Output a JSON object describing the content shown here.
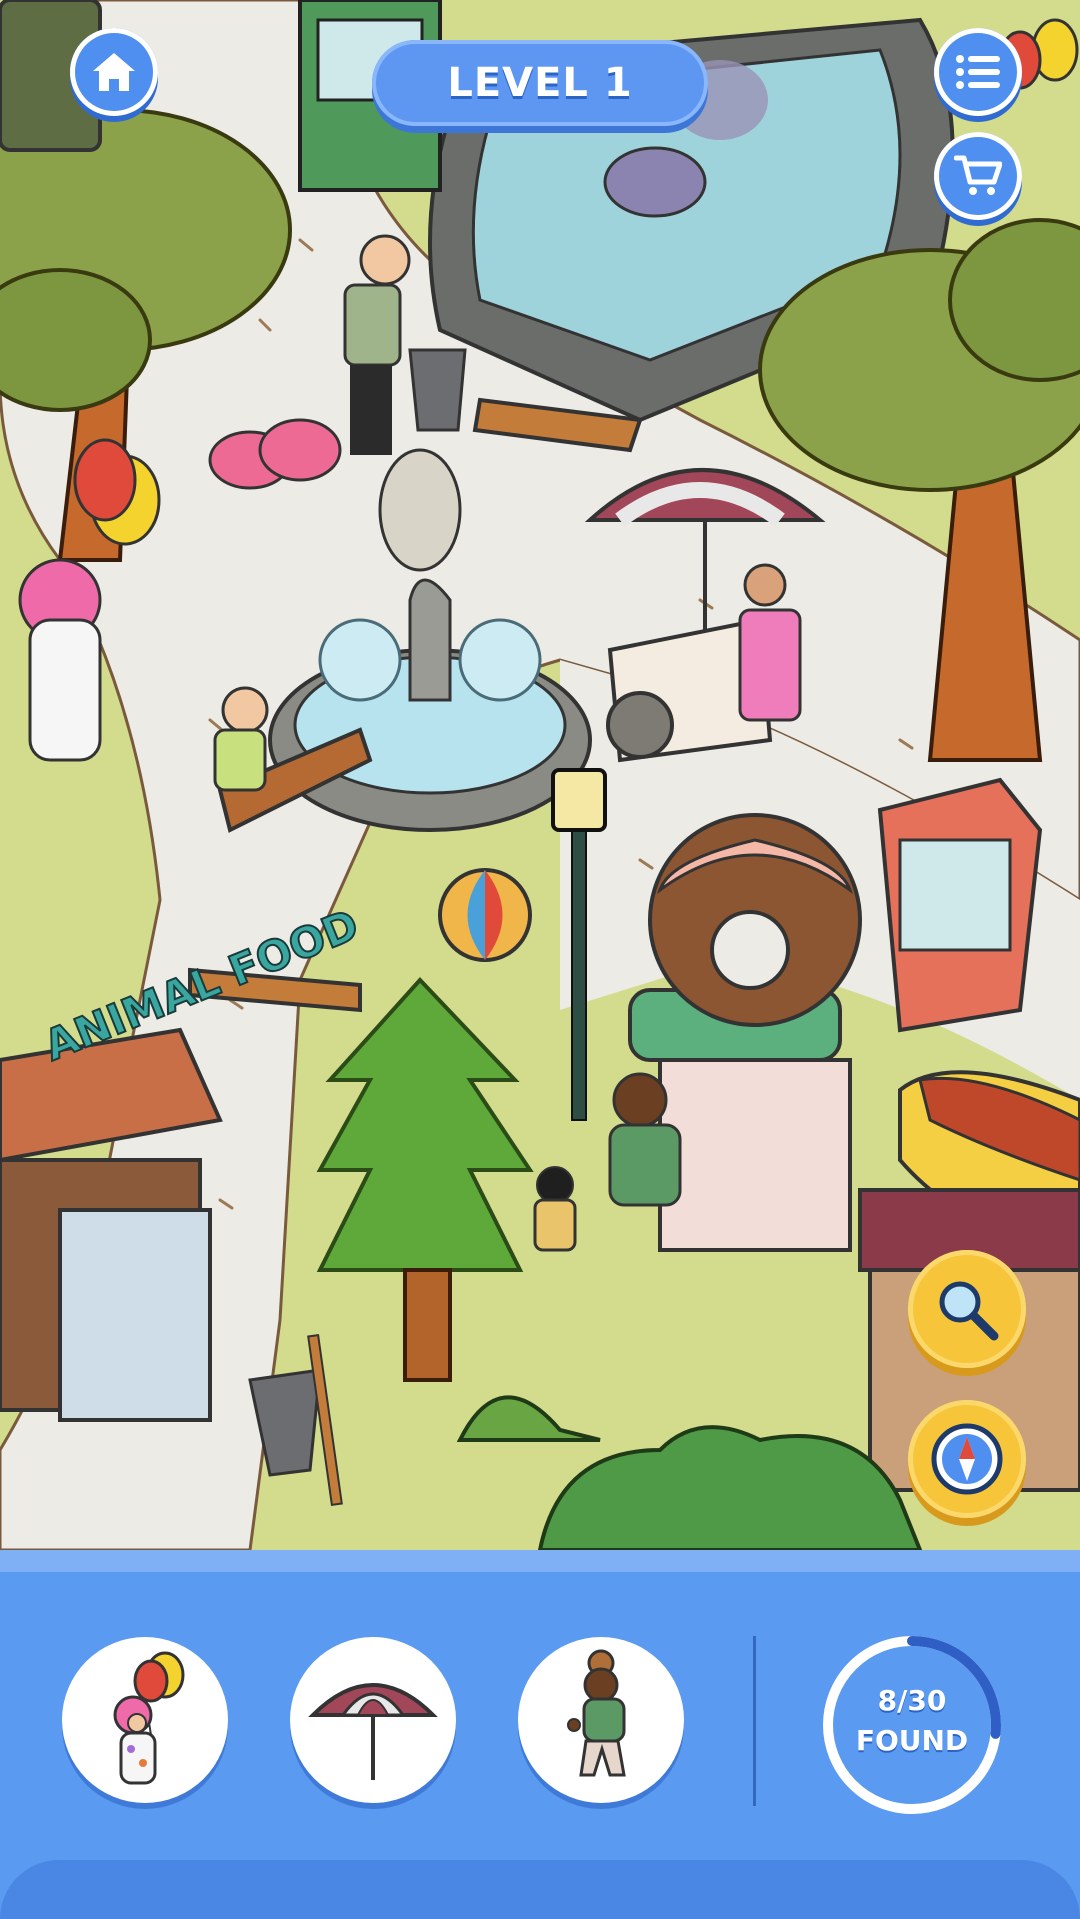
{
  "header": {
    "level_label": "LEVEL 1",
    "home_icon": "home-icon",
    "menu_icon": "list-menu-icon",
    "shop_icon": "shopping-cart-icon"
  },
  "scene": {
    "stall_sign": "ANIMAL FOOD"
  },
  "tools": {
    "hint_icon": "magnifier-icon",
    "compass_icon": "compass-icon"
  },
  "targets": [
    {
      "name": "clown-with-balloons",
      "icon": "clown-icon"
    },
    {
      "name": "striped-umbrella",
      "icon": "umbrella-icon"
    },
    {
      "name": "man-with-donut-hat",
      "icon": "man-icon"
    }
  ],
  "progress": {
    "found": 8,
    "total": 30,
    "count_text": "8/30",
    "label": "FOUND"
  },
  "colors": {
    "accent_blue": "#5b9af1",
    "tool_yellow": "#f7c53a",
    "progress_ring": "#2f5fc4"
  }
}
